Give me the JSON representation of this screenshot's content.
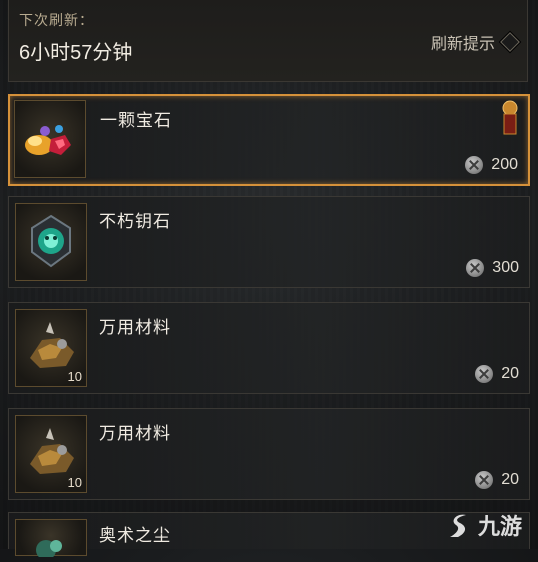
{
  "header": {
    "refresh_label": "下次刷新：",
    "refresh_time": "6小时57分钟",
    "hint_label": "刷新提示"
  },
  "items": [
    {
      "name": "一颗宝石",
      "price": "200",
      "quantity": "",
      "selected": true,
      "icon": "gem-icon"
    },
    {
      "name": "不朽钥石",
      "price": "300",
      "quantity": "",
      "selected": false,
      "icon": "keystone-icon"
    },
    {
      "name": "万用材料",
      "price": "20",
      "quantity": "10",
      "selected": false,
      "icon": "material-icon"
    },
    {
      "name": "万用材料",
      "price": "20",
      "quantity": "10",
      "selected": false,
      "icon": "material-icon"
    },
    {
      "name": "奥术之尘",
      "price": "",
      "quantity": "",
      "selected": false,
      "icon": "arcane-dust-icon"
    }
  ],
  "watermark": "九游"
}
